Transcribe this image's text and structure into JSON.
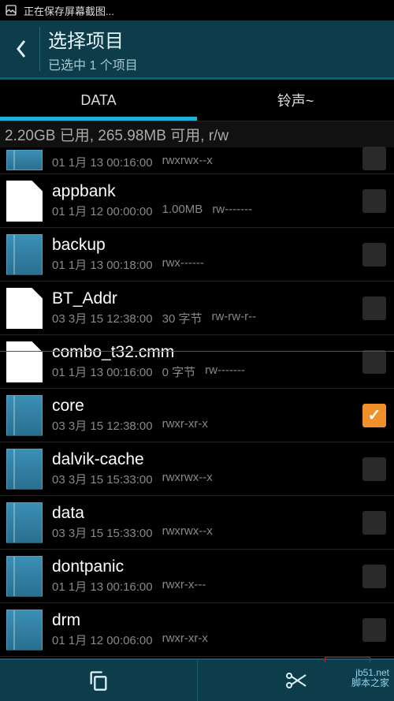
{
  "status_bar": {
    "saving_text": "正在保存屏幕截图..."
  },
  "header": {
    "title": "选择项目",
    "subtitle": "已选中 1 个项目"
  },
  "tabs": [
    {
      "label": "DATA",
      "active": true
    },
    {
      "label": "铃声~",
      "active": false
    }
  ],
  "storage_line": "2.20GB 已用, 265.98MB 可用, r/w",
  "files": [
    {
      "type": "folder",
      "name": "",
      "date": "01 1月 13 00:16:00",
      "size": "",
      "perm": "rwxrwx--x",
      "checked": false,
      "partial": true
    },
    {
      "type": "file",
      "name": "appbank",
      "date": "01 1月 12 00:00:00",
      "size": "1.00MB",
      "perm": "rw-------",
      "checked": false
    },
    {
      "type": "folder",
      "name": "backup",
      "date": "01 1月 13 00:18:00",
      "size": "",
      "perm": "rwx------",
      "checked": false
    },
    {
      "type": "file",
      "name": "BT_Addr",
      "date": "03 3月 15 12:38:00",
      "size": "30 字节",
      "perm": "rw-rw-r--",
      "checked": false
    },
    {
      "type": "file",
      "name": "combo_t32.cmm",
      "date": "01 1月 13 00:16:00",
      "size": "0 字节",
      "perm": "rw-------",
      "checked": false
    },
    {
      "type": "folder",
      "name": "core",
      "date": "03 3月 15 12:38:00",
      "size": "",
      "perm": "rwxr-xr-x",
      "checked": true
    },
    {
      "type": "folder",
      "name": "dalvik-cache",
      "date": "03 3月 15 15:33:00",
      "size": "",
      "perm": "rwxrwx--x",
      "checked": false
    },
    {
      "type": "folder",
      "name": "data",
      "date": "03 3月 15 15:33:00",
      "size": "",
      "perm": "rwxrwx--x",
      "checked": false
    },
    {
      "type": "folder",
      "name": "dontpanic",
      "date": "01 1月 13 00:16:00",
      "size": "",
      "perm": "rwxr-x---",
      "checked": false
    },
    {
      "type": "folder",
      "name": "drm",
      "date": "01 1月 12 00:06:00",
      "size": "",
      "perm": "rwxr-xr-x",
      "checked": false
    }
  ],
  "bottom_icons": {
    "copy": "copy-icon",
    "cut": "cut-icon"
  },
  "watermark": {
    "line1": "jb51.net",
    "line2": "脚本之家"
  }
}
